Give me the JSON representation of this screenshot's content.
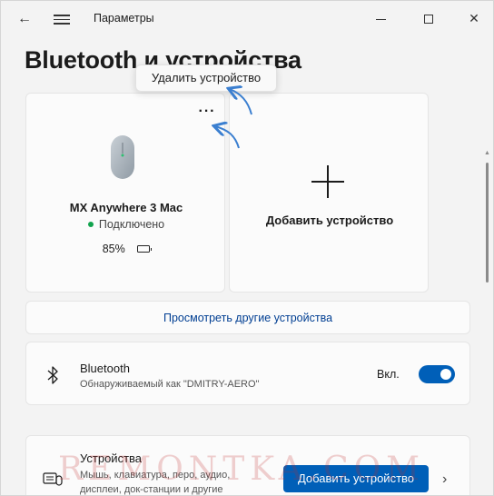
{
  "window": {
    "title": "Параметры",
    "back_icon": "←",
    "menu_icon": "hamburger-icon",
    "close_glyph": "✕"
  },
  "page": {
    "title": "Bluetooth и устройства"
  },
  "popup": {
    "label": "Удалить устройство"
  },
  "device_card": {
    "more_glyph": "···",
    "name": "MX Anywhere 3 Mac",
    "status": "Подключено",
    "battery_text": "85%",
    "battery_level": 0.85,
    "status_color": "#11a34d"
  },
  "add_card": {
    "label": "Добавить устройство"
  },
  "view_more": {
    "label": "Просмотреть другие устройства"
  },
  "bluetooth": {
    "title": "Bluetooth",
    "subtitle": "Обнаруживаемый как \"DMITRY-AERO\"",
    "state": "Вкл.",
    "enabled": true
  },
  "devices": {
    "title": "Устройства",
    "subtitle_line1": "Мышь, клавиатура, перо, аудио,",
    "subtitle_line2": "дисплеи, док-станции и другие",
    "button": "Добавить устройство",
    "chevron": "›"
  },
  "watermark": "REMONTKA.COM",
  "colors": {
    "accent": "#005fb8",
    "link": "#003e92",
    "annotation_arrow": "#3b7fd0"
  }
}
